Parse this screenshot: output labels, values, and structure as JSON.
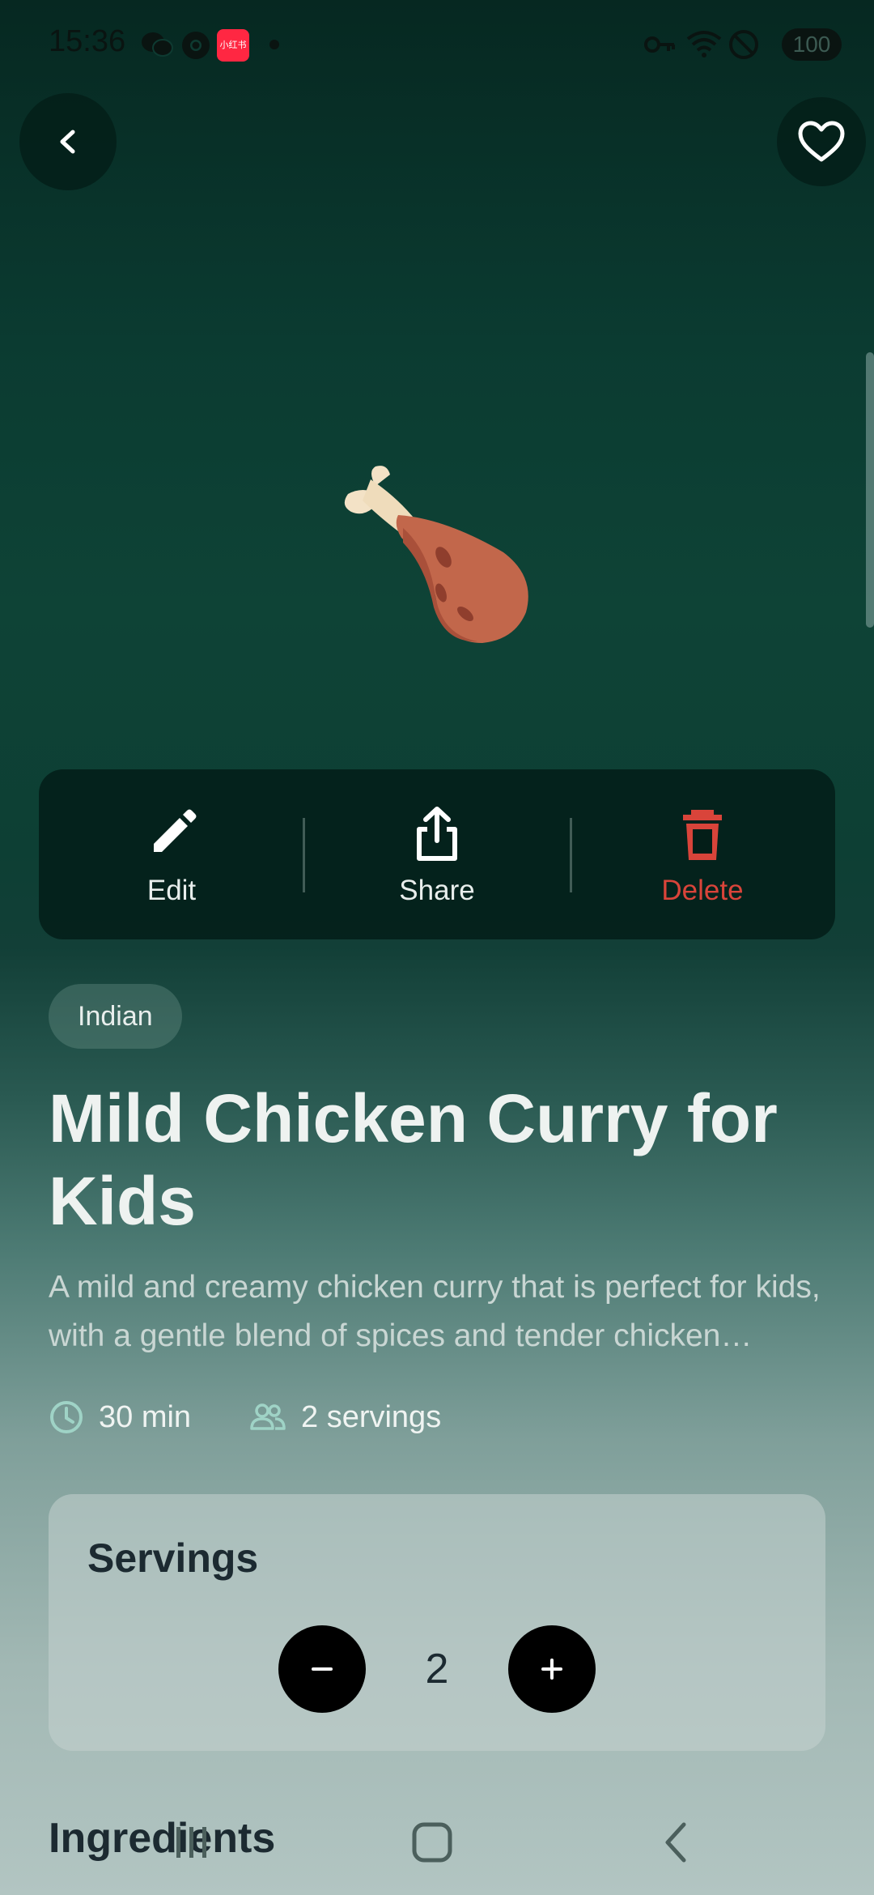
{
  "status_bar": {
    "time": "15:36",
    "notification_icons": [
      "wechat-icon",
      "chrome-icon",
      "xiaohongshu-icon",
      "dot-icon"
    ],
    "app_badge_text": "小红书",
    "system_icons": [
      "vpn-key-icon",
      "wifi-icon",
      "do-not-disturb-icon"
    ],
    "battery": "100"
  },
  "header": {
    "back_icon": "chevron-left-icon",
    "favorite_icon": "heart-outline-icon"
  },
  "hero": {
    "icon": "chicken-leg-icon"
  },
  "actions": {
    "edit_label": "Edit",
    "share_label": "Share",
    "delete_label": "Delete",
    "delete_color": "#d9443a"
  },
  "recipe": {
    "cuisine": "Indian",
    "title": "Mild Chicken Curry for Kids",
    "description": "A mild and creamy chicken curry that is perfect for kids, with a gentle blend of spices and tender chicken pieces.",
    "time": "30 min",
    "servings": "2 servings"
  },
  "servings_card": {
    "title": "Servings",
    "value": "2",
    "minus_label": "−",
    "plus_label": "+"
  },
  "sections": {
    "ingredients": "Ingredients"
  },
  "nav": {
    "recent_icon": "recent-apps-icon",
    "home_icon": "home-icon",
    "back_icon": "back-icon"
  }
}
